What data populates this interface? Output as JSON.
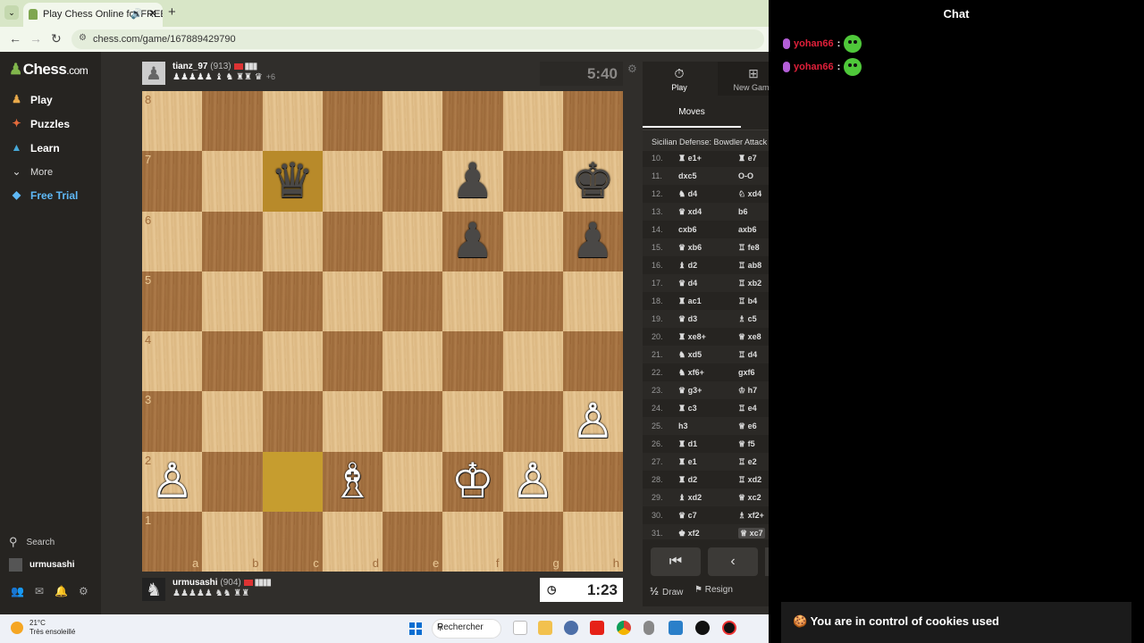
{
  "browser": {
    "tab_title": "Play Chess Online for FREE",
    "tab_audio_icon": "speaker-icon",
    "tab_close": "✕",
    "new_tab": "+",
    "url": "chess.com/game/167889429790"
  },
  "sidebar": {
    "logo": "Chess",
    "logo_suffix": ".com",
    "items": [
      {
        "label": "Play",
        "icon": "pawn-icon"
      },
      {
        "label": "Puzzles",
        "icon": "puzzle-icon"
      },
      {
        "label": "Learn",
        "icon": "learn-icon"
      },
      {
        "label": "More",
        "icon": "chevron-down-icon"
      },
      {
        "label": "Free Trial",
        "icon": "diamond-icon"
      }
    ],
    "search": "Search",
    "username": "urmusashi"
  },
  "top_player": {
    "name": "tianz_97",
    "rating": "(913)",
    "signal": "▮▮▮",
    "captured": "♟♟♟♟♟ ♝ ♞ ♜♜ ♛",
    "advantage": "+6"
  },
  "bottom_player": {
    "name": "urmusashi",
    "rating": "(904)",
    "signal": "▮▮▮▮",
    "captured": "♟♟♟♟♟ ♞♞ ♜♜"
  },
  "clocks": {
    "top": "5:40",
    "bottom": "1:23"
  },
  "board": {
    "ranks": [
      "8",
      "7",
      "6",
      "5",
      "4",
      "3",
      "2",
      "1"
    ],
    "files": [
      "a",
      "b",
      "c",
      "d",
      "e",
      "f",
      "g",
      "h"
    ],
    "highlight_squares": [
      "c7",
      "c2"
    ],
    "pieces": [
      {
        "square": "c7",
        "piece": "♛",
        "color": "black"
      },
      {
        "square": "f7",
        "piece": "♟",
        "color": "black"
      },
      {
        "square": "h7",
        "piece": "♚",
        "color": "black"
      },
      {
        "square": "f6",
        "piece": "♟",
        "color": "black"
      },
      {
        "square": "h6",
        "piece": "♟",
        "color": "black"
      },
      {
        "square": "h3",
        "piece": "♙",
        "color": "white"
      },
      {
        "square": "a2",
        "piece": "♙",
        "color": "white"
      },
      {
        "square": "d2",
        "piece": "♗",
        "color": "white"
      },
      {
        "square": "f2",
        "piece": "♔",
        "color": "white"
      },
      {
        "square": "g2",
        "piece": "♙",
        "color": "white"
      }
    ]
  },
  "panel": {
    "tab_play": "Play",
    "tab_new": "New Game",
    "moves_tab": "Moves",
    "opening": "Sicilian Defense: Bowdler Attack",
    "moves": [
      {
        "n": "10.",
        "w": "♜ e1+",
        "b": "♜ e7"
      },
      {
        "n": "11.",
        "w": "dxc5",
        "b": "O-O"
      },
      {
        "n": "12.",
        "w": "♞ d4",
        "b": "♘ xd4"
      },
      {
        "n": "13.",
        "w": "♛ xd4",
        "b": "b6"
      },
      {
        "n": "14.",
        "w": "cxb6",
        "b": "axb6"
      },
      {
        "n": "15.",
        "w": "♛ xb6",
        "b": "♖ fe8"
      },
      {
        "n": "16.",
        "w": "♝ d2",
        "b": "♖ ab8"
      },
      {
        "n": "17.",
        "w": "♛ d4",
        "b": "♖ xb2"
      },
      {
        "n": "18.",
        "w": "♜ ac1",
        "b": "♖ b4"
      },
      {
        "n": "19.",
        "w": "♛ d3",
        "b": "♗ c5"
      },
      {
        "n": "20.",
        "w": "♜ xe8+",
        "b": "♕ xe8"
      },
      {
        "n": "21.",
        "w": "♞ xd5",
        "b": "♖ d4"
      },
      {
        "n": "22.",
        "w": "♞ xf6+",
        "b": "gxf6"
      },
      {
        "n": "23.",
        "w": "♛ g3+",
        "b": "♔ h7"
      },
      {
        "n": "24.",
        "w": "♜ c3",
        "b": "♖ e4"
      },
      {
        "n": "25.",
        "w": "h3",
        "b": "♕ e6"
      },
      {
        "n": "26.",
        "w": "♜ d1",
        "b": "♕ f5"
      },
      {
        "n": "27.",
        "w": "♜ e1",
        "b": "♖ e2"
      },
      {
        "n": "28.",
        "w": "♜ d2",
        "b": "♖ xd2"
      },
      {
        "n": "29.",
        "w": "♝ xd2",
        "b": "♕ xc2"
      },
      {
        "n": "30.",
        "w": "♛ c7",
        "b": "♗ xf2+"
      },
      {
        "n": "31.",
        "w": "♚ xf2",
        "b": "♕ xc7"
      }
    ],
    "draw": "Draw",
    "resign": "Resign"
  },
  "chat": {
    "title": "Chat",
    "messages": [
      {
        "user": "yohan66",
        "emote": "green-emote-icon"
      },
      {
        "user": "yohan66",
        "emote": "green-emote-icon"
      }
    ],
    "cookie_banner": "You are in control of cookies used"
  },
  "taskbar": {
    "temperature": "21°C",
    "weather": "Très ensoleillé",
    "search": "Rechercher"
  }
}
